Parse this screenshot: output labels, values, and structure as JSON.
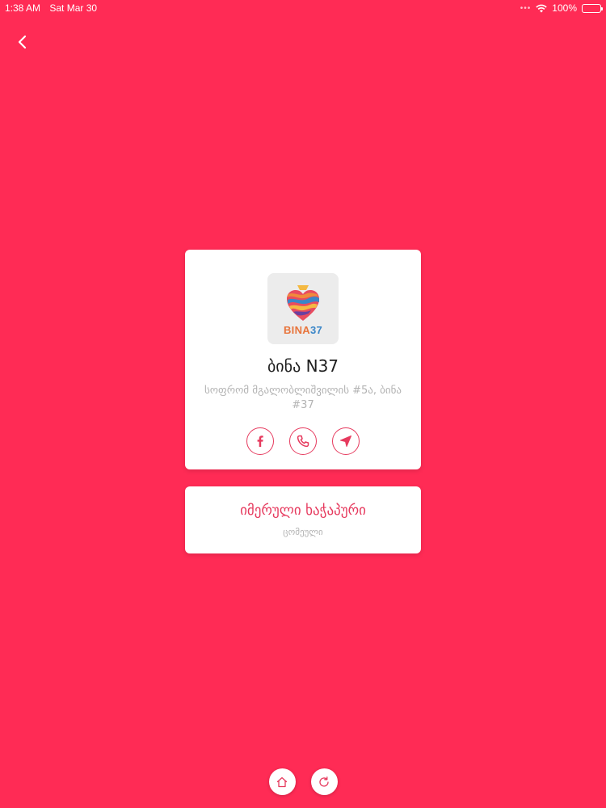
{
  "status_bar": {
    "time": "1:38 AM",
    "date": "Sat Mar 30",
    "battery": "100%",
    "battery_level": 1.0
  },
  "nav": {
    "back_icon": "chevron-left-icon"
  },
  "venue": {
    "logo_text_a": "BINA",
    "logo_text_b": "37",
    "name": "ბინა N37",
    "address": "სოფრომ მგალობლიშვილის #5ა, ბინა #37",
    "actions": [
      {
        "icon": "facebook-icon"
      },
      {
        "icon": "phone-icon"
      },
      {
        "icon": "navigation-icon"
      }
    ]
  },
  "dish": {
    "title": "იმერული ხაჭაპური",
    "subtitle": "ცომეული"
  },
  "bottom_bar": [
    {
      "icon": "home-icon"
    },
    {
      "icon": "refresh-icon"
    }
  ],
  "colors": {
    "background": "#ff2b55",
    "accent": "#e63a5e",
    "muted_text": "#b3b3b3",
    "card": "#ffffff"
  }
}
